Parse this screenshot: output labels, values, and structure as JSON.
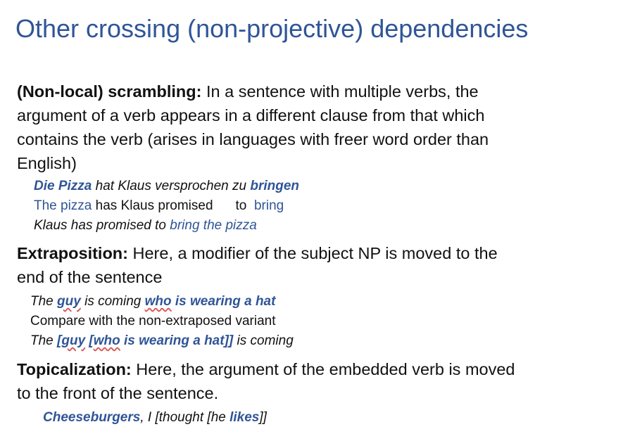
{
  "title": "Other crossing (non-projective) dependencies",
  "scrambling": {
    "term": "(Non-local) scrambling:",
    "line1": " In a sentence with multiple verbs, the",
    "line2": "argument of a verb appears in a different clause from that which",
    "line3": "contains the verb (arises in languages with freer word order than",
    "line4": "English)",
    "ex1": {
      "w1": "Die Pizza",
      "w2": " hat Klaus versprochen zu ",
      "w3": "bringen"
    },
    "ex2": {
      "w1": "The pizza",
      "w2": " has Klaus promised",
      "w3": "to",
      "w4": "bring"
    },
    "ex3": {
      "w1": "Klaus has promised to ",
      "w2": "bring the pizza"
    }
  },
  "extraposition": {
    "term": "Extraposition:",
    "line1": " Here, a modifier of the subject NP is moved to the",
    "line2": "end of the sentence",
    "ex1": {
      "w1": "The ",
      "w2": "guy",
      "w3": " is coming ",
      "w4": "who",
      "w5": " is wearing a hat"
    },
    "compare": "Compare with the non-extraposed variant",
    "ex2": {
      "w1": "The ",
      "w2": "[",
      "w3": "guy",
      "w4": " [",
      "w5": "who",
      "w6": " is wearing a hat]]",
      "w7": " is coming"
    }
  },
  "topicalization": {
    "term": "Topicalization:",
    "line1": " Here, the argument of the embedded verb is moved",
    "line2": "to the front of the sentence.",
    "ex1": {
      "w1": "Cheeseburgers",
      "w2": ", I [thought [he ",
      "w3": "likes",
      "w4": "]]"
    }
  }
}
